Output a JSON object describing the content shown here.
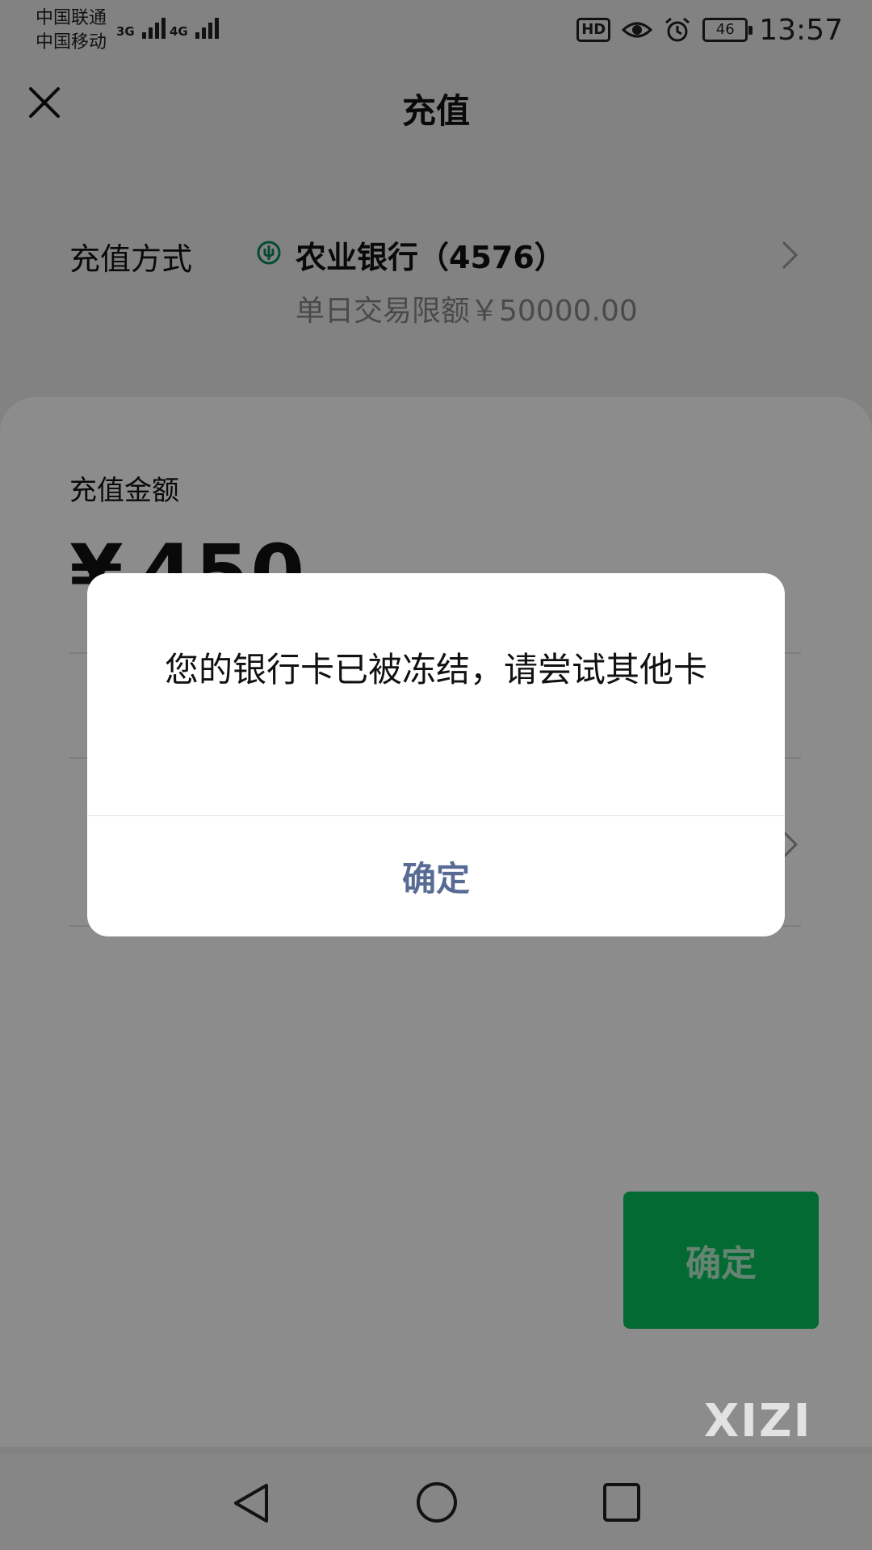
{
  "status_bar": {
    "carrier_1": "中国联通",
    "carrier_2": "中国移动",
    "network_1": "3G",
    "network_2": "4G",
    "hd_label": "HD",
    "battery": "46",
    "time": "13:57",
    "icons": [
      "signal-icon",
      "eye-icon",
      "alarm-icon",
      "battery-icon"
    ]
  },
  "header": {
    "title": "充值",
    "close_icon": "close-icon"
  },
  "payment_method": {
    "label": "充值方式",
    "bank_name": "农业银行（4576）",
    "limit_text": "单日交易限额￥50000.00",
    "icon": "bank-logo-icon"
  },
  "amount": {
    "label": "充值金额",
    "currency": "¥",
    "value": "450"
  },
  "confirm_button": {
    "label": "确定",
    "color": "#07c160"
  },
  "dialog": {
    "message": "您的银行卡已被冻结，请尝试其他卡",
    "button_label": "确定",
    "button_color": "#576b95"
  },
  "watermark": "XIZI",
  "nav_bar": {
    "icons": [
      "back-icon",
      "home-icon",
      "recent-apps-icon"
    ]
  }
}
